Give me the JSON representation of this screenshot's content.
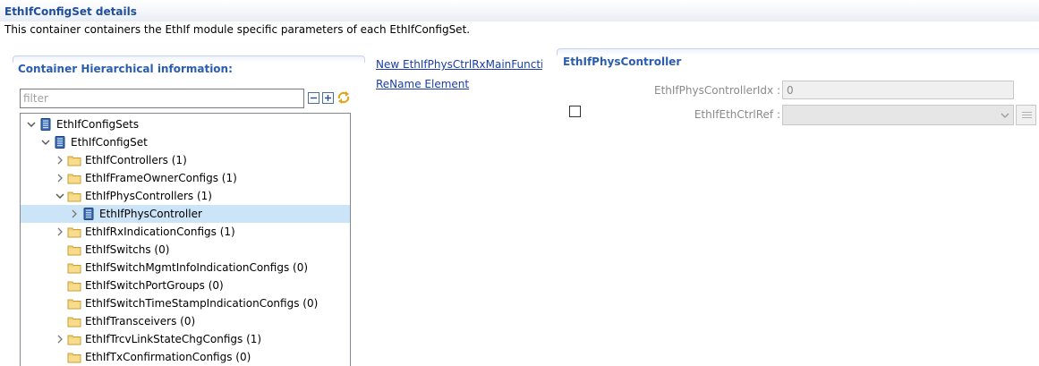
{
  "header": {
    "title": "EthIfConfigSet details",
    "description": "This container containers the EthIf module specific parameters of each EthIfConfigSet."
  },
  "left_panel": {
    "title": "Container Hierarchical information:",
    "filter_placeholder": "filter",
    "toolbar": {
      "collapse_icon": "collapse-all-icon",
      "expand_icon": "expand-all-icon",
      "sync_icon": "sync-link-icon"
    },
    "tree": [
      {
        "label": "EthIfConfigSets",
        "level": 0,
        "twisty": "expanded",
        "icon": "module-icon",
        "selected": false
      },
      {
        "label": "EthIfConfigSet",
        "level": 1,
        "twisty": "expanded",
        "icon": "module-icon",
        "selected": false
      },
      {
        "label": "EthIfControllers (1)",
        "level": 2,
        "twisty": "collapsed",
        "icon": "folder-icon",
        "selected": false
      },
      {
        "label": "EthIfFrameOwnerConfigs (1)",
        "level": 2,
        "twisty": "collapsed",
        "icon": "folder-icon",
        "selected": false
      },
      {
        "label": "EthIfPhysControllers (1)",
        "level": 2,
        "twisty": "expanded",
        "icon": "folder-icon",
        "selected": false
      },
      {
        "label": "EthIfPhysController",
        "level": 3,
        "twisty": "collapsed",
        "icon": "module-icon",
        "selected": true
      },
      {
        "label": "EthIfRxIndicationConfigs (1)",
        "level": 2,
        "twisty": "collapsed",
        "icon": "folder-icon",
        "selected": false
      },
      {
        "label": "EthIfSwitchs (0)",
        "level": 2,
        "twisty": "none",
        "icon": "folder-icon",
        "selected": false
      },
      {
        "label": "EthIfSwitchMgmtInfoIndicationConfigs (0)",
        "level": 2,
        "twisty": "none",
        "icon": "folder-icon",
        "selected": false
      },
      {
        "label": "EthIfSwitchPortGroups (0)",
        "level": 2,
        "twisty": "none",
        "icon": "folder-icon",
        "selected": false
      },
      {
        "label": "EthIfSwitchTimeStampIndicationConfigs (0)",
        "level": 2,
        "twisty": "none",
        "icon": "folder-icon",
        "selected": false
      },
      {
        "label": "EthIfTransceivers (0)",
        "level": 2,
        "twisty": "none",
        "icon": "folder-icon",
        "selected": false
      },
      {
        "label": "EthIfTrcvLinkStateChgConfigs (1)",
        "level": 2,
        "twisty": "collapsed",
        "icon": "folder-icon",
        "selected": false
      },
      {
        "label": "EthIfTxConfirmationConfigs (0)",
        "level": 2,
        "twisty": "none",
        "icon": "folder-icon",
        "selected": false
      }
    ]
  },
  "actions": {
    "new_link": "New EthIfPhysCtrlRxMainFunctic",
    "rename_link": "ReName Element"
  },
  "right_panel": {
    "title": "EthIfPhysController",
    "fields": {
      "controller_idx_label": "EthIfPhysControllerIdx :",
      "controller_idx_value": "0",
      "eth_ctrl_ref_label": "EthIfEthCtrlRef :",
      "eth_ctrl_ref_value": ""
    },
    "checkbox_checked": false
  },
  "colors": {
    "title_blue": "#2a5db0",
    "link_blue": "#1a3ea8",
    "selection": "#cce4f7",
    "folder": "#e9c15a"
  }
}
